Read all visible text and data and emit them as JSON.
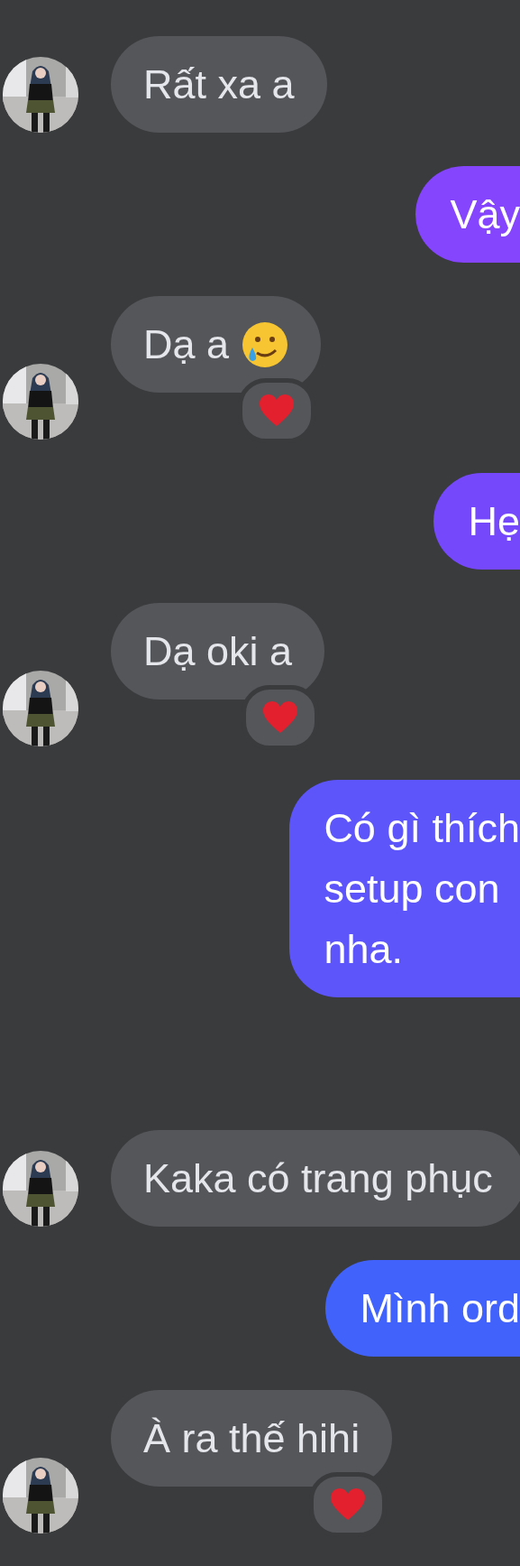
{
  "messages": [
    {
      "kind": "received",
      "lines": [
        "Rất xa a"
      ]
    },
    {
      "kind": "sent",
      "lines": [
        "Vậy"
      ],
      "color": "#8445fc"
    },
    {
      "kind": "received",
      "lines": [
        "Dạ a"
      ],
      "emoji": {
        "kind": "smiling-tear"
      },
      "reaction": {
        "kind": "heart"
      }
    },
    {
      "kind": "sent",
      "lines": [
        "Hẹ"
      ],
      "color": "#7549fb"
    },
    {
      "kind": "received",
      "lines": [
        "Dạ oki a"
      ],
      "reaction": {
        "kind": "heart"
      }
    },
    {
      "kind": "sent",
      "lines": [
        "Có gì thích",
        "setup con",
        "nha."
      ],
      "color": "#5d55fa"
    },
    {
      "kind": "received",
      "lines": [
        "Kaka có trang phục"
      ]
    },
    {
      "kind": "sent",
      "lines": [
        "Mình ord"
      ],
      "color": "#4263fb"
    },
    {
      "kind": "received",
      "lines": [
        "À ra thế hihi"
      ],
      "reaction": {
        "kind": "heart"
      }
    }
  ]
}
